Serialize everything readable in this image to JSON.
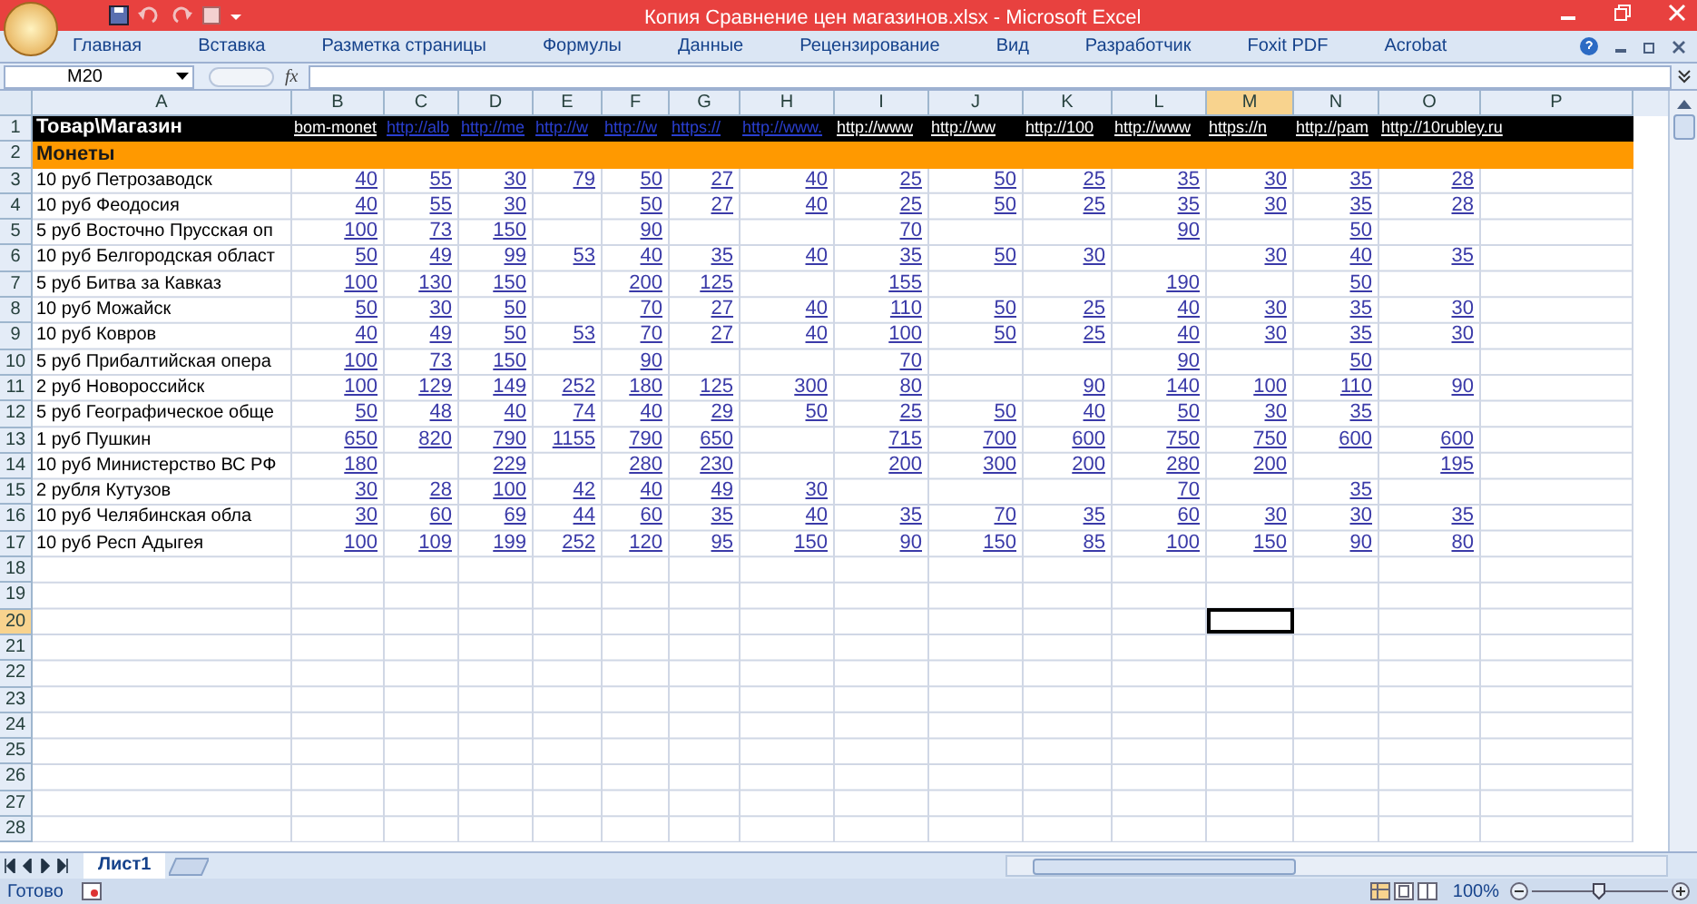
{
  "window": {
    "title": "Копия Сравнение цен магазинов.xlsx - Microsoft Excel"
  },
  "ribbon_tabs": [
    "Главная",
    "Вставка",
    "Разметка страницы",
    "Формулы",
    "Данные",
    "Рецензирование",
    "Вид",
    "Разработчик",
    "Foxit PDF",
    "Acrobat"
  ],
  "name_box": "M20",
  "formula_label": "fx",
  "columns": [
    {
      "label": "A",
      "selected": false
    },
    {
      "label": "B",
      "selected": false
    },
    {
      "label": "C",
      "selected": false
    },
    {
      "label": "D",
      "selected": false
    },
    {
      "label": "E",
      "selected": false
    },
    {
      "label": "F",
      "selected": false
    },
    {
      "label": "G",
      "selected": false
    },
    {
      "label": "H",
      "selected": false
    },
    {
      "label": "I",
      "selected": false
    },
    {
      "label": "J",
      "selected": false
    },
    {
      "label": "K",
      "selected": false
    },
    {
      "label": "L",
      "selected": false
    },
    {
      "label": "M",
      "selected": true
    },
    {
      "label": "N",
      "selected": false
    },
    {
      "label": "O",
      "selected": false
    },
    {
      "label": "P",
      "selected": false
    }
  ],
  "rows": [
    {
      "header": "1",
      "selected": false,
      "kind": "title",
      "name": "Товар\\Магазин",
      "cells": [
        {
          "text": "bom-monet",
          "color": "#ffffff"
        },
        {
          "text": "http://alb",
          "color": "#2a3fd0"
        },
        {
          "text": "http://me",
          "color": "#2a3fd0"
        },
        {
          "text": "http://w",
          "color": "#2a3fd0"
        },
        {
          "text": "http://w",
          "color": "#2a3fd0"
        },
        {
          "text": "https://",
          "color": "#2a3fd0"
        },
        {
          "text": "http://www.",
          "color": "#2a3fd0"
        },
        {
          "text": "http://www",
          "color": "#ffffff"
        },
        {
          "text": "http://ww",
          "color": "#ffffff"
        },
        {
          "text": "http://100",
          "color": "#ffffff"
        },
        {
          "text": "http://www",
          "color": "#ffffff"
        },
        {
          "text": "https://n",
          "color": "#ffffff"
        },
        {
          "text": "http://pam",
          "color": "#ffffff"
        },
        {
          "text": "http://10rubley.ru",
          "color": "#ffffff"
        }
      ]
    },
    {
      "header": "2",
      "selected": false,
      "kind": "section",
      "name": "Монеты"
    },
    {
      "header": "3",
      "selected": false,
      "kind": "item",
      "name": "10 руб Петрозаводск",
      "cells": [
        "40",
        "55",
        "30",
        "79",
        "50",
        "27",
        "40",
        "25",
        "50",
        "25",
        "35",
        "30",
        "35",
        "28"
      ]
    },
    {
      "header": "4",
      "selected": false,
      "kind": "item",
      "name": "10 руб Феодосия",
      "cells": [
        "40",
        "55",
        "30",
        null,
        "50",
        "27",
        "40",
        "25",
        "50",
        "25",
        "35",
        "30",
        "35",
        "28"
      ]
    },
    {
      "header": "5",
      "selected": false,
      "kind": "item",
      "name": "5 руб Восточно Прусская оп",
      "cells": [
        "100",
        "73",
        "150",
        null,
        "90",
        null,
        null,
        "70",
        null,
        null,
        "90",
        null,
        "50",
        null
      ]
    },
    {
      "header": "6",
      "selected": false,
      "kind": "item",
      "name": "10 руб Белгородская област",
      "cells": [
        "50",
        "49",
        "99",
        "53",
        "40",
        "35",
        "40",
        "35",
        "50",
        "30",
        null,
        "30",
        "40",
        "35"
      ]
    },
    {
      "header": "7",
      "selected": false,
      "kind": "item",
      "name": "5 руб Битва за Кавказ",
      "cells": [
        "100",
        "130",
        "150",
        null,
        "200",
        "125",
        null,
        "155",
        null,
        null,
        "190",
        null,
        "50",
        null
      ]
    },
    {
      "header": "8",
      "selected": false,
      "kind": "item",
      "name": "10 руб Можайск",
      "cells": [
        "50",
        "30",
        "50",
        null,
        "70",
        "27",
        "40",
        "110",
        "50",
        "25",
        "40",
        "30",
        "35",
        "30"
      ]
    },
    {
      "header": "9",
      "selected": false,
      "kind": "item",
      "name": "10 руб Ковров",
      "cells": [
        "40",
        "49",
        "50",
        "53",
        "70",
        "27",
        "40",
        "100",
        "50",
        "25",
        "40",
        "30",
        "35",
        "30"
      ]
    },
    {
      "header": "10",
      "selected": false,
      "kind": "item",
      "name": "5 руб Прибалтийская опера",
      "cells": [
        "100",
        "73",
        "150",
        null,
        "90",
        null,
        null,
        "70",
        null,
        null,
        "90",
        null,
        "50",
        null
      ]
    },
    {
      "header": "11",
      "selected": false,
      "kind": "item",
      "name": "2 руб Новороссийск",
      "cells": [
        "100",
        "129",
        "149",
        "252",
        "180",
        "125",
        "300",
        "80",
        null,
        "90",
        "140",
        "100",
        "110",
        "90"
      ]
    },
    {
      "header": "12",
      "selected": false,
      "kind": "item",
      "name": "5 руб Географическое обще",
      "cells": [
        "50",
        "48",
        "40",
        "74",
        "40",
        "29",
        "50",
        "25",
        "50",
        "40",
        "50",
        "30",
        "35",
        null
      ]
    },
    {
      "header": "13",
      "selected": false,
      "kind": "item",
      "name": "1 руб Пушкин",
      "cells": [
        "650",
        "820",
        "790",
        "1155",
        "790",
        "650",
        null,
        "715",
        "700",
        "600",
        "750",
        "750",
        "600",
        "600"
      ]
    },
    {
      "header": "14",
      "selected": false,
      "kind": "item",
      "name": "10 руб Министерство ВС РФ",
      "cells": [
        "180",
        null,
        "229",
        null,
        "280",
        "230",
        null,
        "200",
        "300",
        "200",
        "280",
        "200",
        null,
        "195"
      ]
    },
    {
      "header": "15",
      "selected": false,
      "kind": "item",
      "name": "2 рубля Кутузов",
      "cells": [
        "30",
        "28",
        "100",
        "42",
        "40",
        "49",
        "30",
        null,
        null,
        null,
        "70",
        null,
        "35",
        null
      ]
    },
    {
      "header": "16",
      "selected": false,
      "kind": "item",
      "name": "10 руб Челябинская обла",
      "cells": [
        "30",
        "60",
        "69",
        "44",
        "60",
        "35",
        "40",
        "35",
        "70",
        "35",
        "60",
        "30",
        "30",
        "35"
      ]
    },
    {
      "header": "17",
      "selected": false,
      "kind": "item",
      "name": "10 руб Респ Адыгея",
      "cells": [
        "100",
        "109",
        "199",
        "252",
        "120",
        "95",
        "150",
        "90",
        "150",
        "85",
        "100",
        "150",
        "90",
        "80"
      ]
    },
    {
      "header": "18",
      "selected": false,
      "kind": "empty"
    },
    {
      "header": "19",
      "selected": false,
      "kind": "empty"
    },
    {
      "header": "20",
      "selected": true,
      "kind": "empty"
    },
    {
      "header": "21",
      "selected": false,
      "kind": "empty"
    },
    {
      "header": "22",
      "selected": false,
      "kind": "empty"
    },
    {
      "header": "23",
      "selected": false,
      "kind": "empty"
    },
    {
      "header": "24",
      "selected": false,
      "kind": "empty"
    },
    {
      "header": "25",
      "selected": false,
      "kind": "empty"
    },
    {
      "header": "26",
      "selected": false,
      "kind": "empty"
    },
    {
      "header": "27",
      "selected": false,
      "kind": "empty"
    },
    {
      "header": "28",
      "selected": false,
      "kind": "empty"
    }
  ],
  "sheet_tabs": [
    {
      "label": "Лист1",
      "selected": true
    }
  ],
  "status_bar": {
    "text": "Готово",
    "zoom": "100%",
    "zoom_slider": {
      "level": 0.5
    }
  }
}
